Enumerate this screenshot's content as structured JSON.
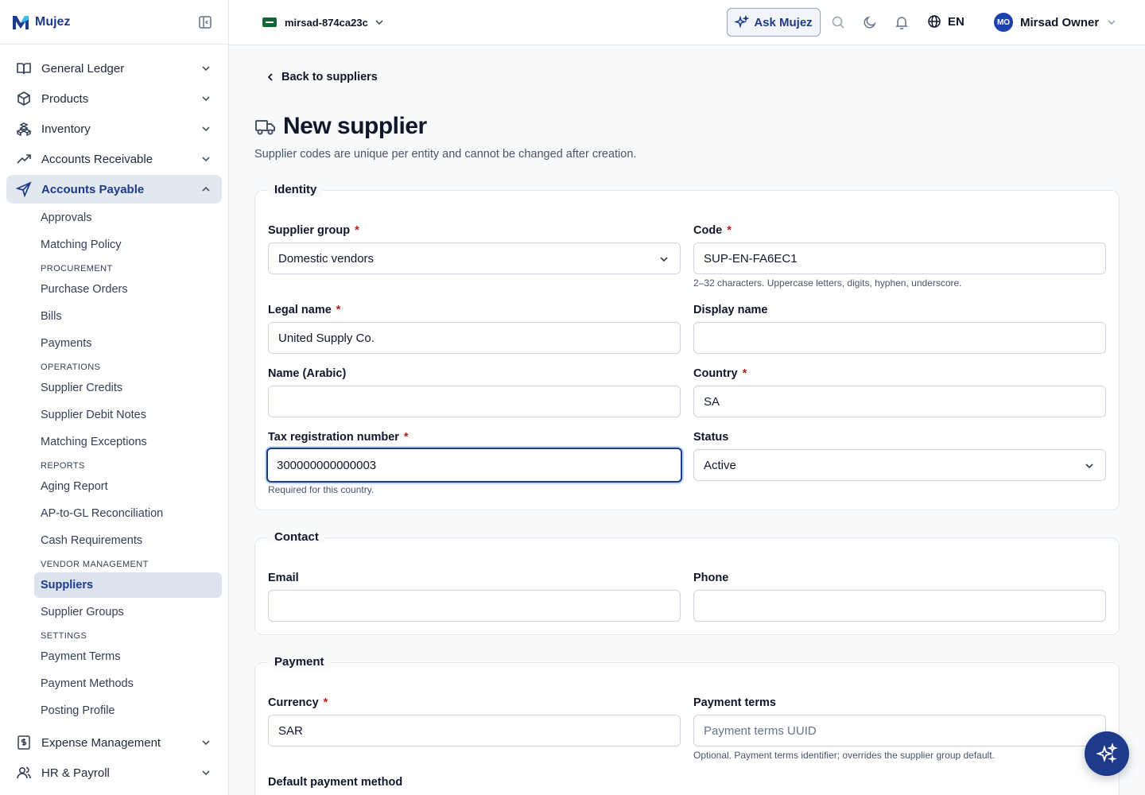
{
  "brand": {
    "name": "Mujez"
  },
  "sidebar": {
    "groups": [
      {
        "label": "General Ledger",
        "icon": "book-open-icon"
      },
      {
        "label": "Products",
        "icon": "package-icon"
      },
      {
        "label": "Inventory",
        "icon": "boxes-icon"
      },
      {
        "label": "Accounts Receivable",
        "icon": "trending-up-icon"
      },
      {
        "label": "Accounts Payable",
        "icon": "send-icon"
      },
      {
        "label": "Expense Management",
        "icon": "receipt-dollar-icon"
      },
      {
        "label": "HR & Payroll",
        "icon": "users-icon"
      }
    ],
    "ap_items": {
      "approvals": "Approvals",
      "matching_policy": "Matching Policy",
      "section_procurement": "PROCUREMENT",
      "purchase_orders": "Purchase Orders",
      "bills": "Bills",
      "payments": "Payments",
      "section_operations": "OPERATIONS",
      "supplier_credits": "Supplier Credits",
      "supplier_debit_notes": "Supplier Debit Notes",
      "matching_exceptions": "Matching Exceptions",
      "section_reports": "REPORTS",
      "aging_report": "Aging Report",
      "ap_gl_reconciliation": "AP-to-GL Reconciliation",
      "cash_requirements": "Cash Requirements",
      "section_vendor": "VENDOR MANAGEMENT",
      "suppliers": "Suppliers",
      "supplier_groups": "Supplier Groups",
      "section_settings": "SETTINGS",
      "payment_terms": "Payment Terms",
      "payment_methods": "Payment Methods",
      "posting_profile": "Posting Profile"
    }
  },
  "topbar": {
    "entity": "mirsad-874ca23c",
    "ask_label": "Ask Mujez",
    "language": "EN",
    "user_initials": "MO",
    "user_name": "Mirsad Owner"
  },
  "page": {
    "back_label": "Back to suppliers",
    "title": "New supplier",
    "subtitle": "Supplier codes are unique per entity and cannot be changed after creation."
  },
  "identity": {
    "legend": "Identity",
    "supplier_group": {
      "label": "Supplier group",
      "value": "Domestic vendors"
    },
    "code": {
      "label": "Code",
      "value": "SUP-EN-FA6EC1",
      "hint": "2–32 characters. Uppercase letters, digits, hyphen, underscore."
    },
    "legal_name": {
      "label": "Legal name",
      "value": "United Supply Co."
    },
    "display_name": {
      "label": "Display name",
      "value": ""
    },
    "name_arabic": {
      "label": "Name (Arabic)",
      "value": ""
    },
    "country": {
      "label": "Country",
      "value": "SA"
    },
    "tax_number": {
      "label": "Tax registration number",
      "value": "300000000000003",
      "hint": "Required for this country."
    },
    "status": {
      "label": "Status",
      "value": "Active"
    }
  },
  "contact": {
    "legend": "Contact",
    "email": {
      "label": "Email",
      "value": ""
    },
    "phone": {
      "label": "Phone",
      "value": ""
    }
  },
  "payment": {
    "legend": "Payment",
    "currency": {
      "label": "Currency",
      "value": "SAR"
    },
    "payment_terms": {
      "label": "Payment terms",
      "value": "",
      "placeholder": "Payment terms UUID",
      "hint": "Optional. Payment terms identifier; overrides the supplier group default."
    },
    "default_method": {
      "label": "Default payment method"
    }
  },
  "required_marker": "*",
  "colors": {
    "accent": "#1e3a8a",
    "required": "#b91c1c",
    "active_bg": "#e2e8f0"
  }
}
